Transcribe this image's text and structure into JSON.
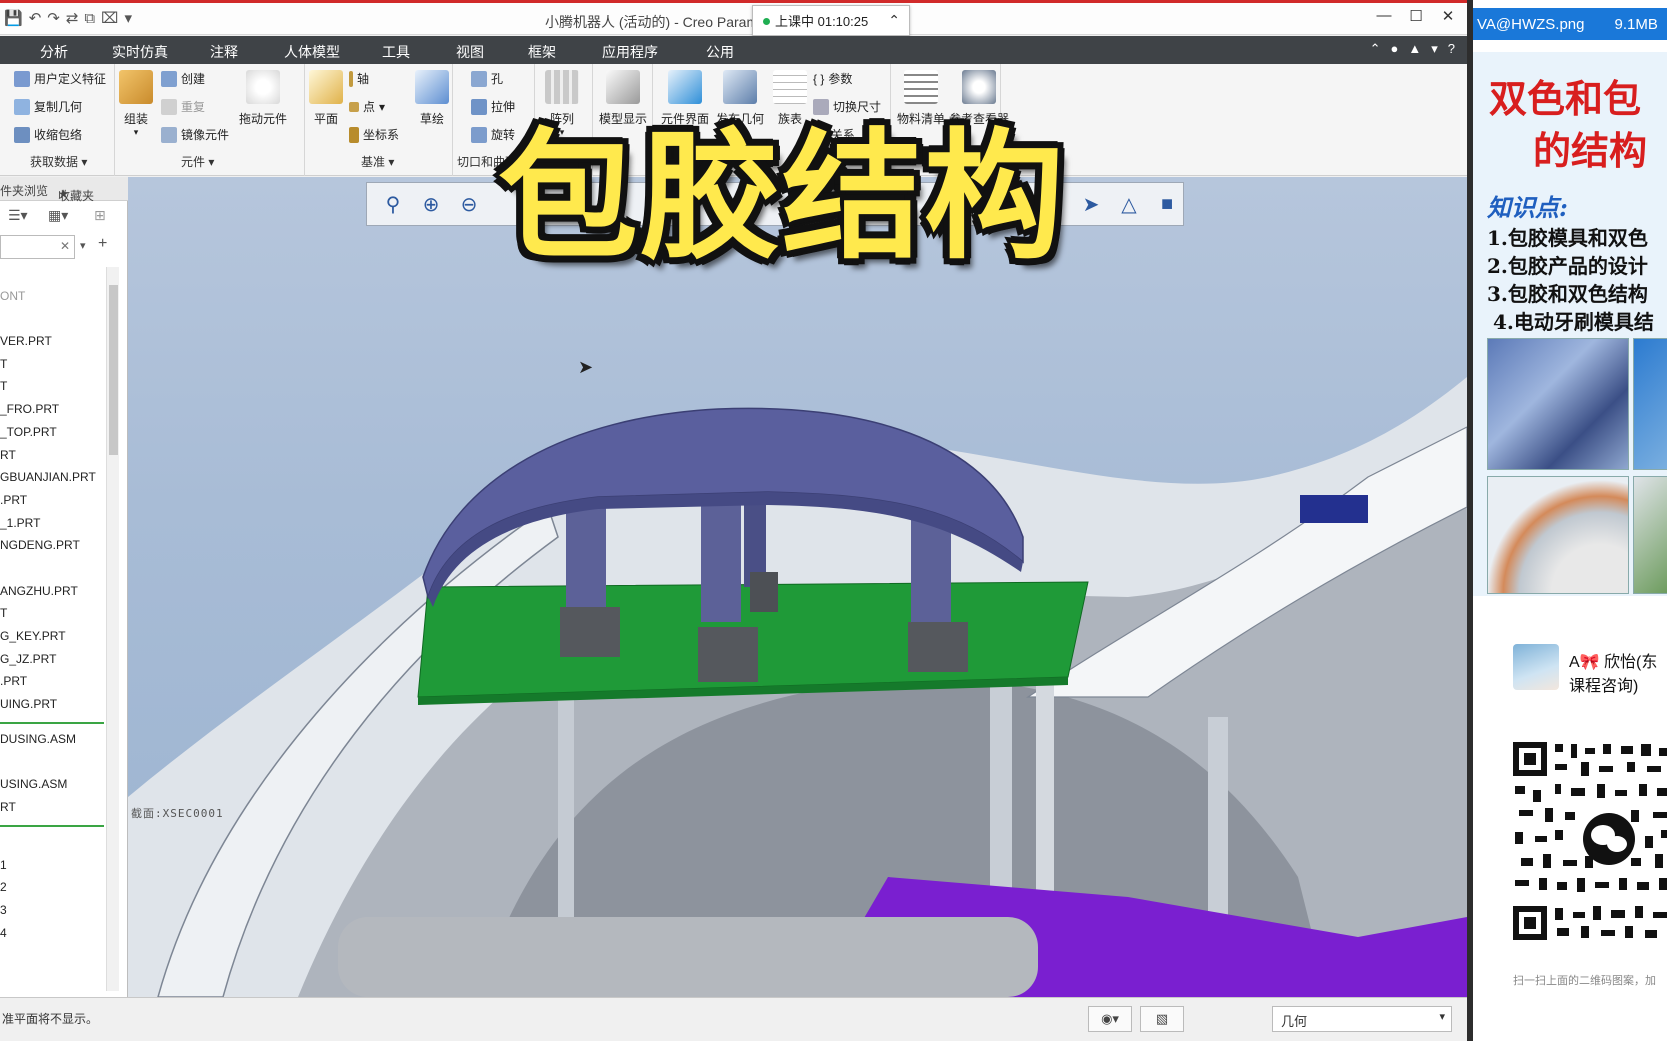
{
  "window": {
    "title": "小腾机器人 (活动的) - Creo Parame",
    "class_timer": "上课中 01:10:25"
  },
  "menu": {
    "tabs": [
      "分析",
      "实时仿真",
      "注释",
      "人体模型",
      "工具",
      "视图",
      "框架",
      "应用程序",
      "公用"
    ]
  },
  "ribbon": {
    "get_data": {
      "user_feature": "用户定义特征",
      "copy_geom": "复制几何",
      "shrinkwrap": "收缩包络",
      "group_label": "获取数据"
    },
    "component": {
      "assemble": "组装",
      "create": "创建",
      "repeat": "重复",
      "mirror": "镜像元件",
      "drag": "拖动元件",
      "group_label": "元件"
    },
    "datum": {
      "plane": "平面",
      "axis": "轴",
      "point": "点",
      "csys": "坐标系",
      "sketch": "草绘",
      "group_label": "基准"
    },
    "cut": {
      "hole": "孔",
      "extrude": "拉伸",
      "revolve": "旋转",
      "group_label": "切口和曲面"
    },
    "pattern": {
      "label": "阵列"
    },
    "model_display": {
      "label": "模型显示"
    },
    "model_intent": {
      "comp_interface": "元件界面",
      "publish_geom": "发布几何",
      "family_table": "族表",
      "params": "参数",
      "switch_dims": "切换尺寸",
      "relations": "关系"
    },
    "investigate": {
      "bom": "物料清单",
      "ref_viewer": "参考查看器"
    }
  },
  "left_panel": {
    "tabs": [
      "件夹浏览",
      "收藏夹"
    ],
    "tree": [
      "ONT",
      "VER.PRT",
      "T",
      "T",
      "_FRO.PRT",
      "_TOP.PRT",
      "RT",
      "GBUANJIAN.PRT",
      ".PRT",
      "_1.PRT",
      "NGDENG.PRT",
      "ANGZHU.PRT",
      "T",
      "G_KEY.PRT",
      "G_JZ.PRT",
      ".PRT",
      "UING.PRT",
      "DUSING.ASM",
      "USING.ASM",
      "RT",
      "1",
      "2",
      "3",
      "4"
    ]
  },
  "viewport": {
    "section_label": "截面:XSEC0001",
    "overlay_title": "包胶结构"
  },
  "status": {
    "message": "准平面将不显示。",
    "filter": "几何"
  },
  "ad": {
    "file_name": "VA@HWZS.png",
    "file_size": "9.1MB",
    "headline_1": "双色和包",
    "headline_2": "的结构",
    "knowledge": "知识点:",
    "points": [
      "1.包胶模具和双色",
      "2.包胶产品的设计",
      "3.包胶和双色结构",
      "4.电动牙刷模具结"
    ],
    "contact_name": "A🎀 欣怡(东",
    "contact_sub": "课程咨询)",
    "scan_tip": "扫一扫上面的二维码图案，加"
  },
  "colors": {
    "menubar": "#3f4347",
    "viewport_bg": "#a8bcd6",
    "overmold_purple": "#5a5f9e",
    "pcb_green": "#1f9a38",
    "overlay_yellow": "#ffe94d",
    "ad_red": "#d81e1e"
  }
}
